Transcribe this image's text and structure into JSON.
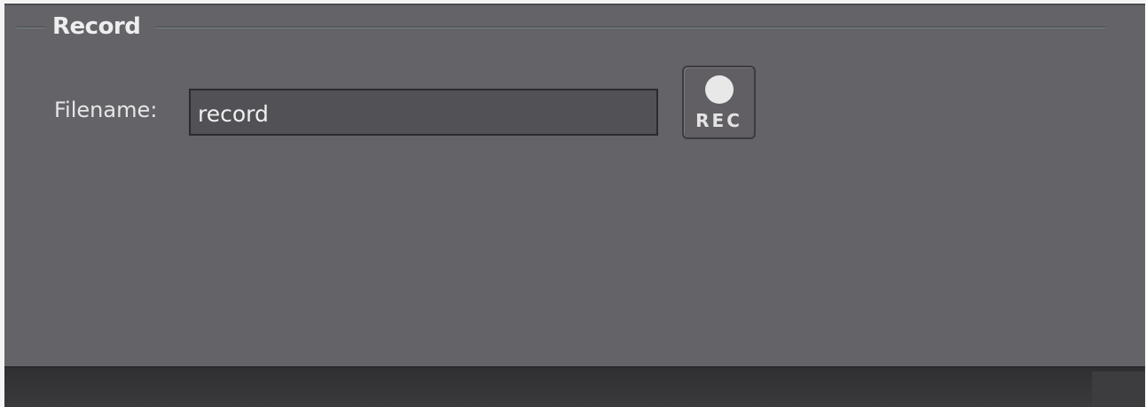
{
  "record_group": {
    "title": "Record",
    "filename_label": "Filename:",
    "filename_value": "record",
    "rec_button_label": "REC",
    "rec_icon": "record-dot-icon"
  }
}
